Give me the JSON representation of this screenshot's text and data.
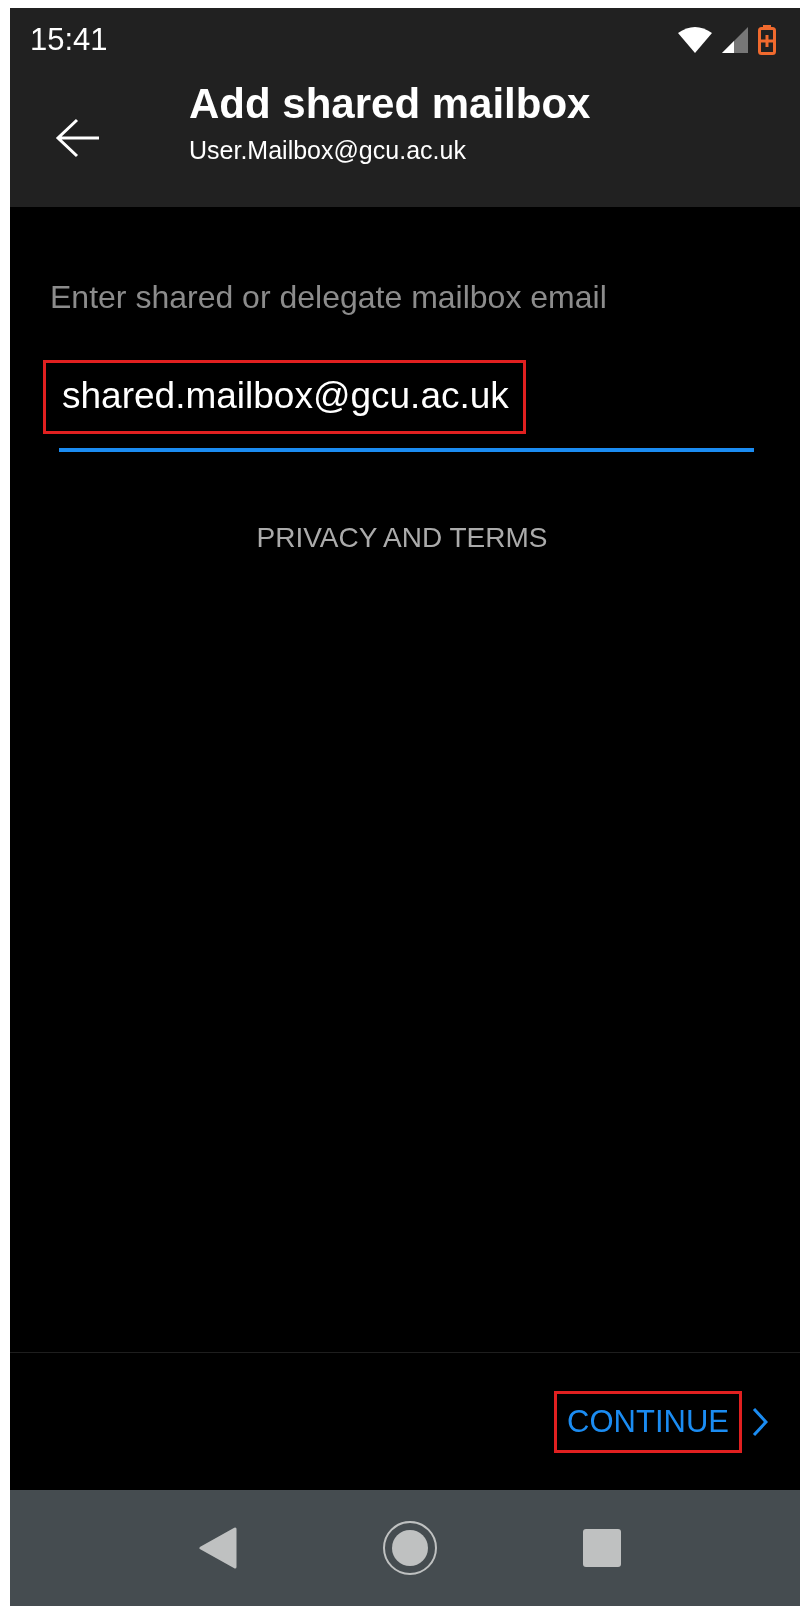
{
  "status_bar": {
    "time": "15:41"
  },
  "header": {
    "title": "Add shared mailbox",
    "subtitle": "User.Mailbox@gcu.ac.uk"
  },
  "form": {
    "label": "Enter shared or delegate mailbox email",
    "email_field": {
      "value": "shared.mailbox@gcu.ac.uk",
      "highlighted": true,
      "focused": true
    },
    "privacy_link": "PRIVACY AND TERMS"
  },
  "footer": {
    "continue_button": {
      "label": "CONTINUE",
      "highlighted": true
    }
  }
}
